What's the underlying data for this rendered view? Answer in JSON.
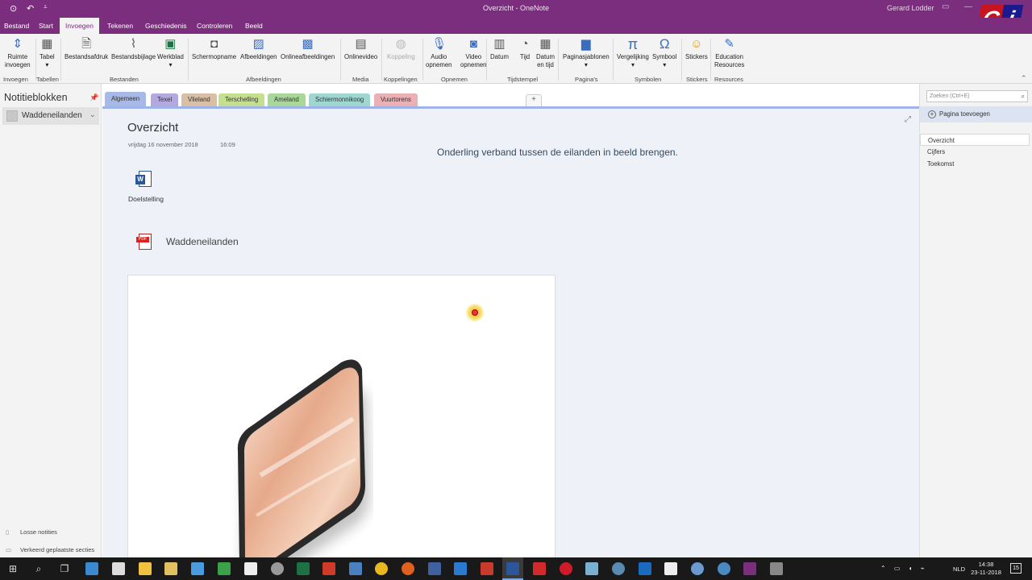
{
  "window": {
    "title": "Overzicht - OneNote",
    "user": "Gerard Lodder"
  },
  "menu": [
    "Bestand",
    "Start",
    "Invoegen",
    "Tekenen",
    "Geschiedenis",
    "Controleren",
    "Beeld"
  ],
  "ribbon": {
    "buttons": [
      {
        "l1": "Ruimte",
        "l2": "invoegen"
      },
      {
        "l1": "Tabel",
        "l2": "▾"
      },
      {
        "l1": "Bestandsafdruk",
        "l2": ""
      },
      {
        "l1": "Bestandsbijlage",
        "l2": ""
      },
      {
        "l1": "Werkblad",
        "l2": "▾"
      },
      {
        "l1": "Schermopname",
        "l2": ""
      },
      {
        "l1": "Afbeeldingen",
        "l2": ""
      },
      {
        "l1": "Onlineafbeeldingen",
        "l2": ""
      },
      {
        "l1": "Onlinevideo",
        "l2": ""
      },
      {
        "l1": "Koppeling",
        "l2": ""
      },
      {
        "l1": "Audio",
        "l2": "opnemen"
      },
      {
        "l1": "Video",
        "l2": "opnemen"
      },
      {
        "l1": "Datum",
        "l2": ""
      },
      {
        "l1": "Tijd",
        "l2": ""
      },
      {
        "l1": "Datum",
        "l2": "en tijd"
      },
      {
        "l1": "Paginasjablonen",
        "l2": "▾"
      },
      {
        "l1": "Vergelijking",
        "l2": "▾"
      },
      {
        "l1": "Symbool",
        "l2": "▾"
      },
      {
        "l1": "Stickers",
        "l2": ""
      },
      {
        "l1": "Education",
        "l2": "Resources"
      }
    ],
    "groups": [
      "Invoegen",
      "Tabellen",
      "Bestanden",
      "Afbeeldingen",
      "Media",
      "Koppelingen",
      "Opnemen",
      "Tijdstempel",
      "Pagina's",
      "Symbolen",
      "Stickers",
      "Resources"
    ]
  },
  "notebooks": {
    "title": "Notitieblokken",
    "current": "Waddeneilanden",
    "quick_notes": "Losse notities",
    "misplaced": "Verkeerd geplaatste secties"
  },
  "sections": [
    {
      "label": "Algemeen",
      "color": "#a7b9e6"
    },
    {
      "label": "Texel",
      "color": "#b3a9e0"
    },
    {
      "label": "Vlieland",
      "color": "#d8bfa6"
    },
    {
      "label": "Terschelling",
      "color": "#c4e08f"
    },
    {
      "label": "Ameland",
      "color": "#a9d79a"
    },
    {
      "label": "Schiermonnikoog",
      "color": "#9fd6d0"
    },
    {
      "label": "Vuurtorens",
      "color": "#eab0b3"
    }
  ],
  "page": {
    "title": "Overzicht",
    "date": "vrijdag 16 november 2018",
    "time": "16:09",
    "headline": "Onderling verband tussen de eilanden in beeld brengen.",
    "attachment_word": "Doelstelling",
    "attachment_pdf": "Waddeneilanden"
  },
  "pages": {
    "search_placeholder": "Zoeken (Ctrl+E)",
    "add_page": "Pagina toevoegen",
    "items": [
      "Overzicht",
      "Cijfers",
      "Toekomst"
    ]
  },
  "taskbar": {
    "language": "NLD",
    "time": "14:38",
    "date": "23-11-2018",
    "notifications": "15"
  }
}
